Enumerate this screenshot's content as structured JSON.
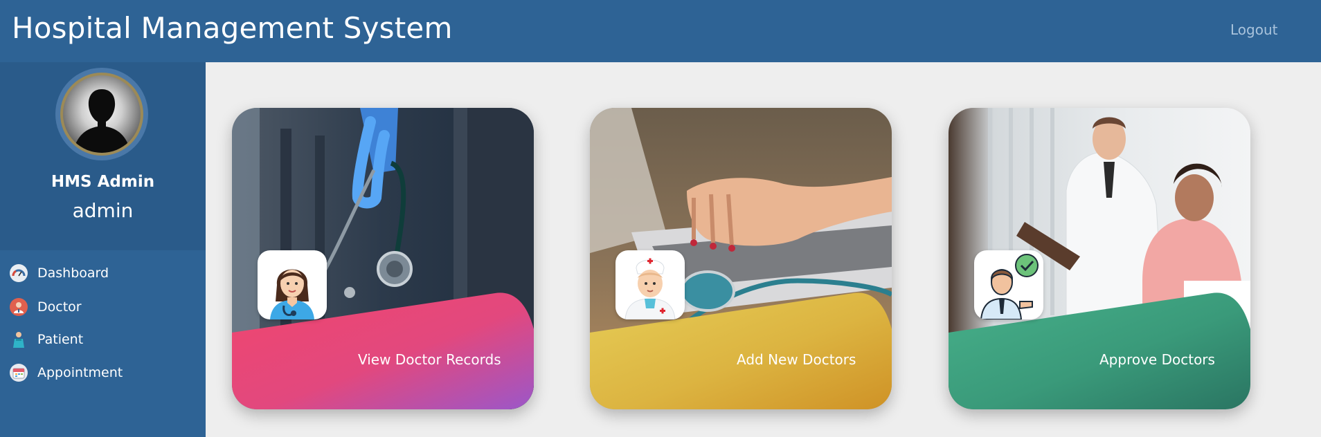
{
  "header": {
    "title": "Hospital Management System",
    "logout_label": "Logout"
  },
  "profile": {
    "name": "HMS Admin",
    "role": "admin"
  },
  "sidebar": {
    "items": [
      {
        "label": "Dashboard",
        "icon": "dashboard-gauge-icon"
      },
      {
        "label": "Doctor",
        "icon": "doctor-icon"
      },
      {
        "label": "Patient",
        "icon": "patient-icon"
      },
      {
        "label": "Appointment",
        "icon": "calendar-icon"
      }
    ]
  },
  "cards": [
    {
      "label": "View Doctor Records",
      "icon": "female-doctor-icon",
      "colors": [
        "#f0466e",
        "#9b57c9"
      ]
    },
    {
      "label": "Add New Doctors",
      "icon": "nurse-doctor-icon",
      "colors": [
        "#e2c24f",
        "#cf9226"
      ]
    },
    {
      "label": "Approve Doctors",
      "icon": "approve-doctor-icon",
      "colors": [
        "#45ad86",
        "#2b7a66"
      ]
    }
  ],
  "colors": {
    "header_bg": "#2e6395",
    "sidebar_bg": "#2e6395",
    "profile_bg": "#2a5b8a",
    "content_bg": "#eeeeee"
  }
}
